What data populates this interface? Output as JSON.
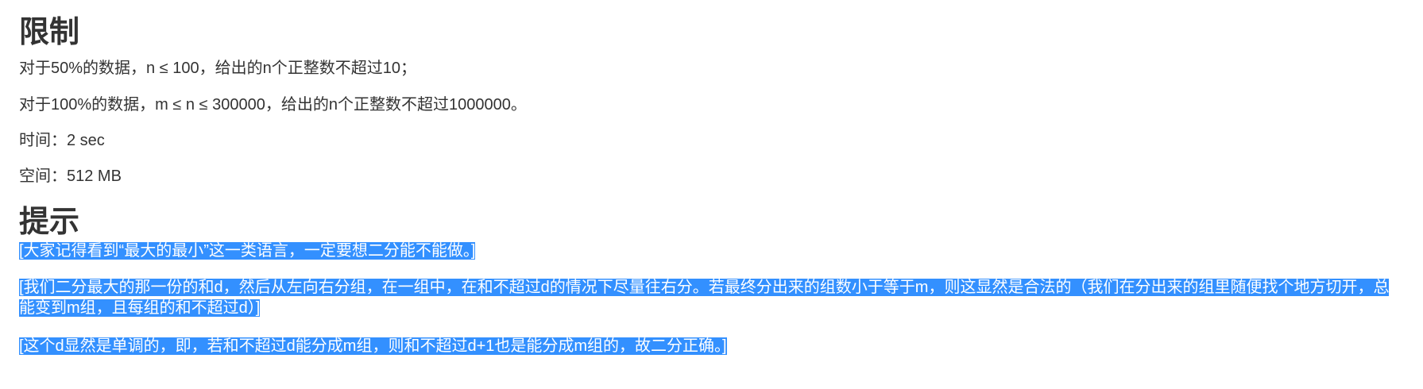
{
  "limits": {
    "heading": "限制",
    "lines": [
      "对于50%的数据，n ≤ 100，给出的n个正整数不超过10；",
      "对于100%的数据，m ≤ n ≤ 300000，给出的n个正整数不超过1000000。",
      "时间：2 sec",
      "空间：512 MB"
    ]
  },
  "hint": {
    "heading": "提示",
    "lines": [
      "[大家记得看到“最大的最小”这一类语言，一定要想二分能不能做。]",
      "[我们二分最大的那一份的和d，然后从左向右分组，在一组中，在和不超过d的情况下尽量往右分。若最终分出来的组数小于等于m，则这显然是合法的（我们在分出来的组里随便找个地方切开，总能变到m组，且每组的和不超过d）]",
      "[这个d显然是单调的，即，若和不超过d能分成m组，则和不超过d+1也是能分成m组的，故二分正确。]"
    ]
  },
  "colors": {
    "selection": "#3390ff",
    "text": "#333333"
  }
}
